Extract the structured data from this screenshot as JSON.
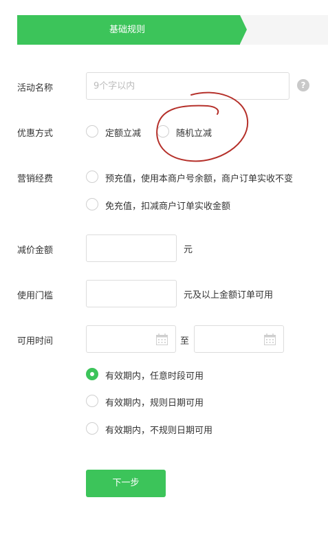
{
  "steps": {
    "active_label": "基础规则"
  },
  "form": {
    "name": {
      "label": "活动名称",
      "placeholder": "9个字以内",
      "value": "",
      "help_glyph": "?"
    },
    "discount_type": {
      "label": "优惠方式",
      "options": [
        "定额立减",
        "随机立减"
      ],
      "selected_index": -1
    },
    "budget": {
      "label": "营销经费",
      "options": [
        "预充值，使用本商户号余额，商户订单实收不变",
        "免充值，扣减商户订单实收金额"
      ],
      "selected_index": -1
    },
    "reduce_amount": {
      "label": "减价金额",
      "value": "",
      "unit": "元"
    },
    "threshold": {
      "label": "使用门槛",
      "value": "",
      "unit": "元及以上金额订单可用"
    },
    "time": {
      "label": "可用时间",
      "separator": "至",
      "start": "",
      "end": "",
      "options": [
        "有效期内，任意时段可用",
        "有效期内，规则日期可用",
        "有效期内，不规则日期可用"
      ],
      "selected_index": 0
    }
  },
  "next_button": {
    "label": "下一步"
  },
  "colors": {
    "accent": "#3cc45a",
    "annotation": "#b5302a"
  },
  "icons": {
    "help": "question-circle-icon",
    "calendar": "calendar-icon"
  }
}
